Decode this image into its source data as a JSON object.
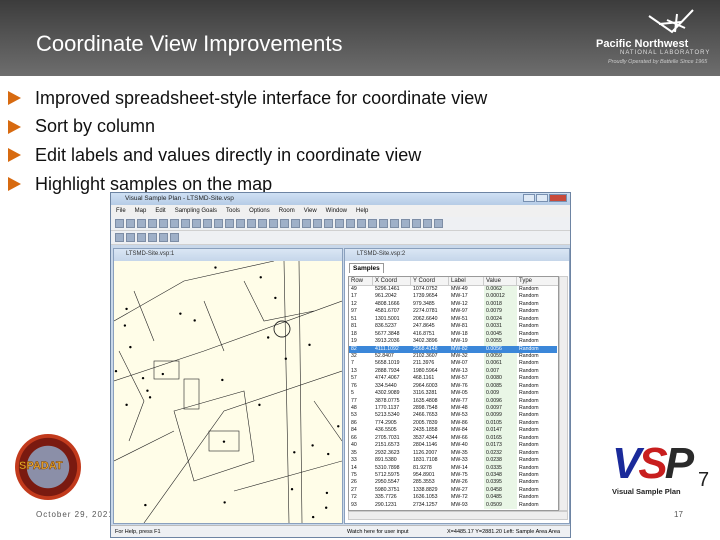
{
  "slide": {
    "title": "Coordinate View Improvements",
    "date": "October 29, 2021",
    "page_number": "17",
    "bullets": [
      "Improved spreadsheet-style interface for coordinate view",
      "Sort by column",
      "Edit labels and values directly in coordinate view",
      "Highlight samples on the map"
    ],
    "logo": {
      "name": "Pacific Northwest",
      "sub": "NATIONAL LABORATORY",
      "tagline": "Proudly Operated by Battelle Since 1965"
    },
    "spadat_logo": "SPADAT",
    "vsp_logo": {
      "mark": "VSP",
      "subtitle": "Visual Sample Plan",
      "version": "7"
    },
    "accent": "#d76a10"
  },
  "app": {
    "title": "Visual Sample Plan - LTSMD-Site.vsp",
    "menu": [
      "File",
      "Map",
      "Edit",
      "Sampling Goals",
      "Tools",
      "Options",
      "Room",
      "View",
      "Window",
      "Help"
    ],
    "map_window_title": "LTSMD-Site.vsp:1",
    "samples_window_title": "LTSMD-Site.vsp:2",
    "samples_tab": "Samples",
    "columns": [
      "Row",
      "X Coord",
      "Y Coord",
      "Label",
      "Value",
      "Type"
    ],
    "selected_row": 8,
    "rows": [
      [
        "49",
        "5296.1461",
        "1074.0752",
        "MW-49",
        "0.0062",
        "Random"
      ],
      [
        "17",
        "961.2042",
        "1739.9654",
        "MW-17",
        "0.00012",
        "Random"
      ],
      [
        "12",
        "4808.1666",
        "979.3485",
        "MW-12",
        "0.0018",
        "Random"
      ],
      [
        "97",
        "4581.6707",
        "2274.0781",
        "MW-97",
        "0.0079",
        "Random"
      ],
      [
        "51",
        "1301.5001",
        "2062.6640",
        "MW-51",
        "0.0024",
        "Random"
      ],
      [
        "81",
        "836.5237",
        "247.8645",
        "MW-81",
        "0.0031",
        "Random"
      ],
      [
        "18",
        "5677.3848",
        "416.8751",
        "MW-18",
        "0.0045",
        "Random"
      ],
      [
        "19",
        "3913.2036",
        "3402.3896",
        "MW-19",
        "0.0055",
        "Random"
      ],
      [
        "82",
        "4111.1092",
        "2568.4148",
        "MW-82",
        "0.0056",
        "Random"
      ],
      [
        "32",
        "52.8407",
        "2102.3607",
        "MW-32",
        "0.0059",
        "Random"
      ],
      [
        "7",
        "5658.1019",
        "211.3976",
        "MW-07",
        "0.0061",
        "Random"
      ],
      [
        "13",
        "2888.7934",
        "1980.5964",
        "MW-13",
        "0.007",
        "Random"
      ],
      [
        "57",
        "4747.4067",
        "468.1161",
        "MW-57",
        "0.0080",
        "Random"
      ],
      [
        "76",
        "334.5440",
        "2964.6003",
        "MW-76",
        "0.0085",
        "Random"
      ],
      [
        "5",
        "4302.9089",
        "3116.3281",
        "MW-05",
        "0.009",
        "Random"
      ],
      [
        "77",
        "3878.0775",
        "1635.4808",
        "MW-77",
        "0.0096",
        "Random"
      ],
      [
        "48",
        "1770.1137",
        "2898.7548",
        "MW-48",
        "0.0097",
        "Random"
      ],
      [
        "53",
        "5213.5340",
        "2466.7653",
        "MW-53",
        "0.0099",
        "Random"
      ],
      [
        "86",
        "774.2905",
        "2005.7839",
        "MW-86",
        "0.0105",
        "Random"
      ],
      [
        "84",
        "436.5505",
        "2435.1858",
        "MW-84",
        "0.0147",
        "Random"
      ],
      [
        "66",
        "2705.7031",
        "3537.4344",
        "MW-66",
        "0.0165",
        "Random"
      ],
      [
        "40",
        "2151.6573",
        "2804.1146",
        "MW-40",
        "0.0173",
        "Random"
      ],
      [
        "35",
        "2932.3623",
        "1126.2007",
        "MW-35",
        "0.0232",
        "Random"
      ],
      [
        "33",
        "891.5380",
        "1831.7108",
        "MW-33",
        "0.0238",
        "Random"
      ],
      [
        "14",
        "5310.7898",
        "81.9278",
        "MW-14",
        "0.0335",
        "Random"
      ],
      [
        "75",
        "5712.5975",
        "954.8901",
        "MW-75",
        "0.0348",
        "Random"
      ],
      [
        "26",
        "2950.5547",
        "285.3553",
        "MW-26",
        "0.0395",
        "Random"
      ],
      [
        "27",
        "5980.3751",
        "1338.8829",
        "MW-27",
        "0.0458",
        "Random"
      ],
      [
        "72",
        "335.7726",
        "1636.1053",
        "MW-72",
        "0.0485",
        "Random"
      ],
      [
        "93",
        "290.1231",
        "2734.1257",
        "MW-93",
        "0.0509",
        "Random"
      ]
    ],
    "status_left": "For Help, press F1",
    "status_mid": "Watch here for user input",
    "status_right": "X=4485.17 Y=2881.20 Left: Sample Area Area"
  }
}
